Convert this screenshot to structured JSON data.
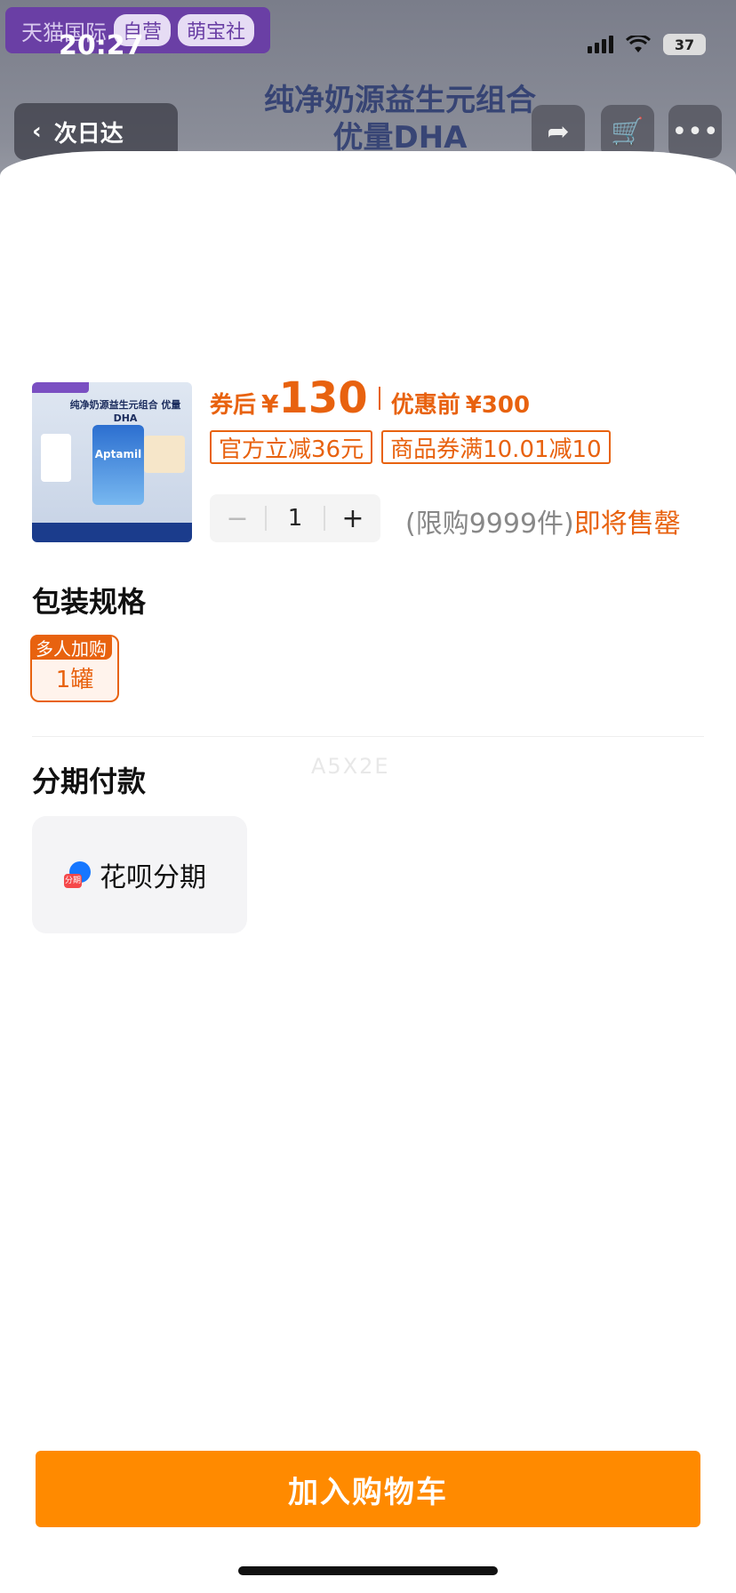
{
  "status_bar": {
    "time": "20:27",
    "battery": "37"
  },
  "background_page": {
    "brand_text": "天猫国际",
    "brand_pill_1": "自营",
    "brand_pill_2": "萌宝社",
    "title_line1": "纯净奶源益生元组合",
    "title_line2": "优量DHA",
    "delivery_badge": "次日达"
  },
  "product": {
    "thumb_title": "纯净奶源益生元组合 优量DHA",
    "thumb_brand": "Aptamil",
    "price_label": "券后",
    "currency": "¥",
    "price_after_coupon": "130",
    "original_label": "优惠前",
    "original_price": "¥300",
    "tags": [
      "官方立减36元",
      "商品券满10.01减10"
    ],
    "quantity": "1",
    "minus_label": "−",
    "plus_label": "+",
    "limit_text": "(限购9999件)",
    "stock_status": "即将售罄"
  },
  "spec": {
    "section_title": "包装规格",
    "ribbon": "多人加购",
    "option": "1罐"
  },
  "installment": {
    "section_title": "分期付款",
    "option_label": "花呗分期",
    "icon_text": "分期"
  },
  "watermark": "A5X2E",
  "cta": {
    "label": "加入购物车"
  },
  "colors": {
    "accent": "#e8620f",
    "cta": "#ff8a00"
  }
}
